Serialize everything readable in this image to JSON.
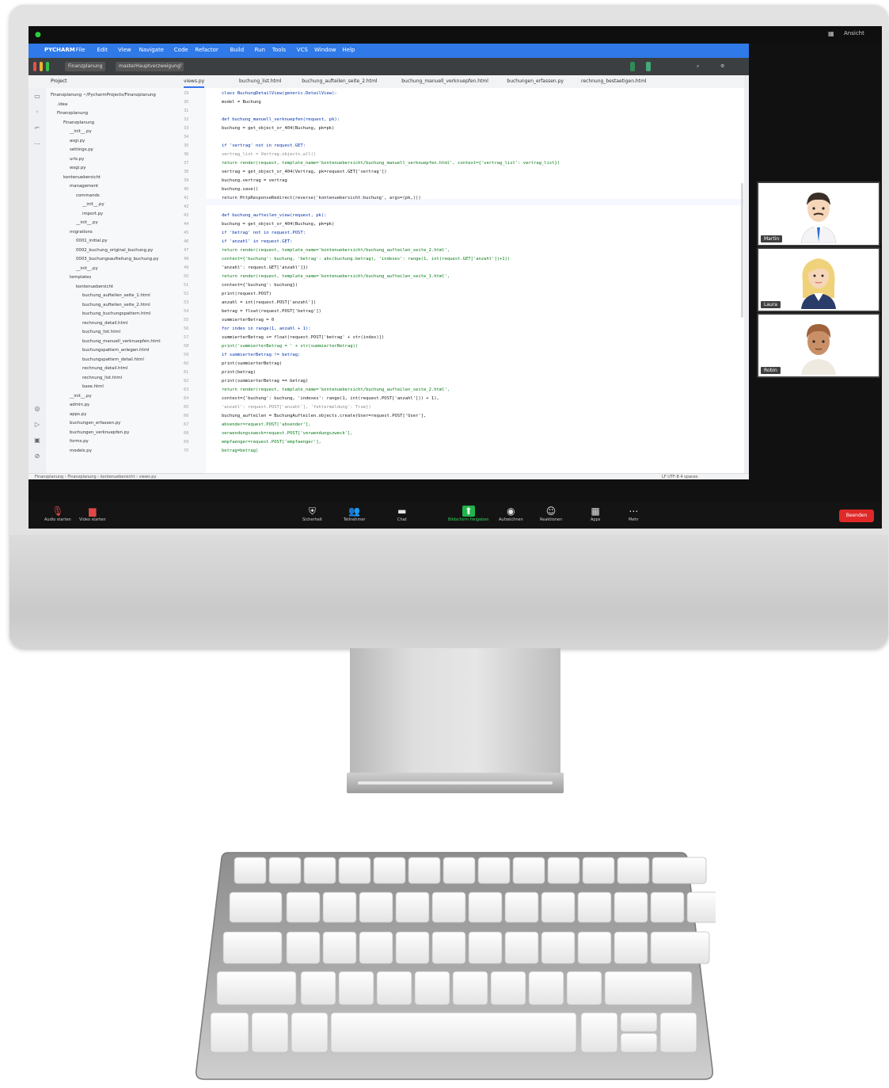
{
  "zoom": {
    "view_label": "Ansicht",
    "end_button": "Beenden",
    "toolbar": [
      {
        "icon": "microphone-muted-icon",
        "label": "Audio starten"
      },
      {
        "icon": "camera-muted-icon",
        "label": "Video starten"
      },
      {
        "icon": "security-icon",
        "label": "Sicherheit"
      },
      {
        "icon": "participants-icon",
        "label": "Teilnehmer"
      },
      {
        "icon": "chat-icon",
        "label": "Chat"
      },
      {
        "icon": "share-screen-icon",
        "label": "Bildschirm freigeben"
      },
      {
        "icon": "record-icon",
        "label": "Aufzeichnen"
      },
      {
        "icon": "reactions-icon",
        "label": "Reaktionen"
      },
      {
        "icon": "apps-icon",
        "label": "Apps"
      },
      {
        "icon": "more-icon",
        "label": "Mehr"
      }
    ],
    "participants": [
      {
        "name": "Martin"
      },
      {
        "name": "Laura"
      },
      {
        "name": "Robin"
      }
    ]
  },
  "ide": {
    "menu": [
      "PYCHARM",
      "File",
      "Edit",
      "View",
      "Navigate",
      "Code",
      "Refactor",
      "Build",
      "Run",
      "Tools",
      "VCS",
      "Window",
      "Help"
    ],
    "project_chip": "Finanzplanung",
    "branch_chip": "masterHauptverzweigung",
    "project_header": "Project",
    "tabs": [
      "views.py",
      "buchung_list.html",
      "buchung_aufteilen_seite_2.html",
      "buchung_manuell_verknuepfen.html",
      "buchungen_erfassen.py",
      "rechnung_bestaetigen.html"
    ],
    "tree": [
      "Finanzplanung ~/PycharmProjects/Finanzplanung",
      ".idea",
      "Finanzplanung",
      "Finanzplanung",
      "__init__.py",
      "asgi.py",
      "settings.py",
      "urls.py",
      "wsgi.py",
      "kontenuebersicht",
      "management",
      "commands",
      "__init__.py",
      "import.py",
      "__init__.py",
      "migrations",
      "0001_initial.py",
      "0002_buchung_original_buchung.py",
      "0003_buchungsaufteilung_buchung.py",
      "__init__.py",
      "templates",
      "kontenuebersicht",
      "buchung_aufteilen_seite_1.html",
      "buchung_aufteilen_seite_2.html",
      "buchung_buchungspattern.html",
      "rechnung_detail.html",
      "buchung_list.html",
      "buchung_manuell_verknuepfen.html",
      "buchungspattern_anlegen.html",
      "buchungspattern_detail.html",
      "rechnung_detail.html",
      "rechnung_list.html",
      "base.html",
      "__init__.py",
      "admin.py",
      "apps.py",
      "buchungen_erfassen.py",
      "buchungen_verknuepfen.py",
      "forms.py",
      "models.py"
    ],
    "code": [
      {
        "t": "class BuchungDetailView(generic.DetailView):",
        "c": "kw",
        "i": 0
      },
      {
        "t": "    model = Buchung",
        "c": "",
        "i": 1
      },
      {
        "t": "",
        "c": "",
        "i": 0
      },
      {
        "t": "def buchung_manuell_verknuepfen(request, pk):",
        "c": "kw",
        "i": 0
      },
      {
        "t": "    buchung = get_object_or_404(Buchung, pk=pk)",
        "c": "",
        "i": 1
      },
      {
        "t": "",
        "c": "",
        "i": 0
      },
      {
        "t": "    if 'vertrag' not in request.GET:",
        "c": "kw",
        "i": 1
      },
      {
        "t": "        vertrag_list = Vertrag.objects.all()",
        "c": "muted",
        "i": 2
      },
      {
        "t": "        return render(request, template_name='kontenuebersicht/buchung_manuell_verknuepfen.html', context={'vertrag_list': vertrag_list})",
        "c": "str",
        "i": 2
      },
      {
        "t": "    vertrag = get_object_or_404(Vertrag, pk=request.GET['vertrag'])",
        "c": "",
        "i": 1
      },
      {
        "t": "    buchung.vertrag = vertrag",
        "c": "",
        "i": 1
      },
      {
        "t": "    buchung.save()",
        "c": "",
        "i": 1
      },
      {
        "t": "    return HttpResponseRedirect(reverse('kontenuebersicht:buchung', args=(pk,)))",
        "c": "",
        "i": 1
      },
      {
        "t": "",
        "c": "",
        "i": 0
      },
      {
        "t": "def buchung_aufteilen_view(request, pk):",
        "c": "kw",
        "i": 0
      },
      {
        "t": "    buchung = get_object_or_404(Buchung, pk=pk)",
        "c": "",
        "i": 1
      },
      {
        "t": "    if 'betrag' not in request.POST:",
        "c": "kw",
        "i": 1
      },
      {
        "t": "        if 'anzahl' in request.GET:",
        "c": "kw",
        "i": 2
      },
      {
        "t": "            return render(request, template_name='kontenuebersicht/buchung_aufteilen_seite_2.html',",
        "c": "str",
        "i": 3
      },
      {
        "t": "                          context={'buchung': buchung, 'betrag': abs(buchung.betrag), 'indexes': range(1, int(request.GET['anzahl'])+1))",
        "c": "str",
        "i": 3
      },
      {
        "t": "                                   'anzahl': request.GET['anzahl']})",
        "c": "",
        "i": 3
      },
      {
        "t": "        return render(request, template_name='kontenuebersicht/buchung_aufteilen_seite_1.html',",
        "c": "str",
        "i": 2
      },
      {
        "t": "                      context={'buchung': buchung})",
        "c": "",
        "i": 2
      },
      {
        "t": "    print(request.POST)",
        "c": "",
        "i": 1
      },
      {
        "t": "    anzahl = int(request.POST['anzahl'])",
        "c": "",
        "i": 1
      },
      {
        "t": "    betrag = float(request.POST['betrag'])",
        "c": "",
        "i": 1
      },
      {
        "t": "    summierterBetrag = 0",
        "c": "",
        "i": 1
      },
      {
        "t": "    for index in range(1, anzahl + 1):",
        "c": "kw",
        "i": 1
      },
      {
        "t": "        summierterBetrag += float(request.POST['betrag' + str(index)])",
        "c": "",
        "i": 2
      },
      {
        "t": "        print('summierterBetrag = ' + str(summierterBetrag))",
        "c": "str",
        "i": 2
      },
      {
        "t": "    if summierterBetrag != betrag:",
        "c": "kw",
        "i": 1
      },
      {
        "t": "        print(summierterBetrag)",
        "c": "",
        "i": 2
      },
      {
        "t": "        print(betrag)",
        "c": "",
        "i": 2
      },
      {
        "t": "        print(summierterBetrag == betrag)",
        "c": "",
        "i": 2
      },
      {
        "t": "        return render(request, template_name='kontenuebersicht/buchung_aufteilen_seite_2.html',",
        "c": "str",
        "i": 2
      },
      {
        "t": "                      context={'buchung': buchung, 'indexes': range(1, int(request.POST['anzahl'])) + 1),",
        "c": "",
        "i": 2
      },
      {
        "t": "                               'anzahl': request.POST['anzahl'], 'fehlermeldung': True})",
        "c": "muted",
        "i": 2
      },
      {
        "t": "    buchung_aufteilen = BuchungAufteilen.objects.create(User=request.POST['User'],",
        "c": "",
        "i": 1
      },
      {
        "t": "                                                         absender=request.POST['absender'],",
        "c": "str",
        "i": 6
      },
      {
        "t": "                                                         verwendungszweck=request.POST['verwendungszweck'],",
        "c": "str",
        "i": 6
      },
      {
        "t": "                                                         empfaenger=request.POST['empfaenger'],",
        "c": "str",
        "i": 6
      },
      {
        "t": "                                                         betrag=betrag)",
        "c": "str",
        "i": 6
      }
    ],
    "status": "Finanzplanung › Finanzplanung › kontenuebersicht › views.py",
    "status_right": "LF   UTF-8   4 spaces"
  }
}
